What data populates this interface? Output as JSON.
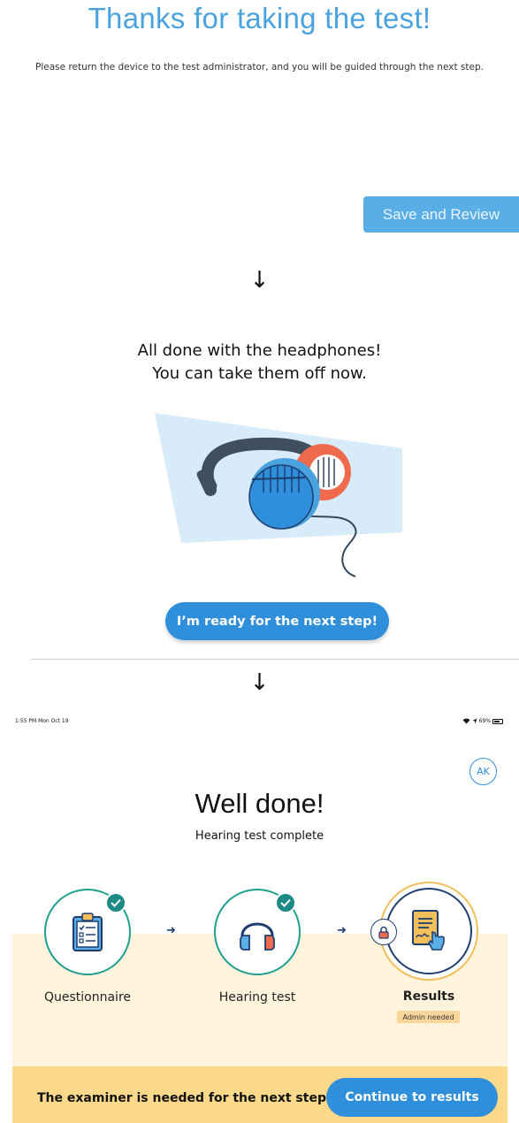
{
  "section1": {
    "title": "Thanks for taking the test!",
    "subtitle": "Please return the device to the test administrator, and you will be guided through the next step.",
    "save_button": "Save and Review"
  },
  "arrows": {
    "down": "↓"
  },
  "section2": {
    "line1": "All done with the headphones!",
    "line2": "You can take them off now.",
    "illustration_icon": "headphones-illustration",
    "ready_button": "I’m ready for the next step!"
  },
  "section3": {
    "status_time": "1:55 PM  Mon Oct 19",
    "status_battery": "69%",
    "avatar_initials": "AK",
    "title": "Well done!",
    "subtitle": "Hearing test complete",
    "step_arrow": "➜",
    "steps": [
      {
        "label": "Questionnaire",
        "icon": "clipboard-checklist-icon",
        "state": "complete"
      },
      {
        "label": "Hearing test",
        "icon": "headphones-icon",
        "state": "complete"
      },
      {
        "label": "Results",
        "icon": "signed-document-icon",
        "state": "locked",
        "badge": "Admin needed"
      }
    ],
    "footer_text": "The examiner is needed for the next step",
    "continue_button": "Continue to results"
  },
  "colors": {
    "accent_blue": "#2f8fdb",
    "teal": "#1d9e8e",
    "navy": "#1f3e70",
    "cream": "#fff3dc",
    "footer_yellow": "#fbd98b"
  }
}
